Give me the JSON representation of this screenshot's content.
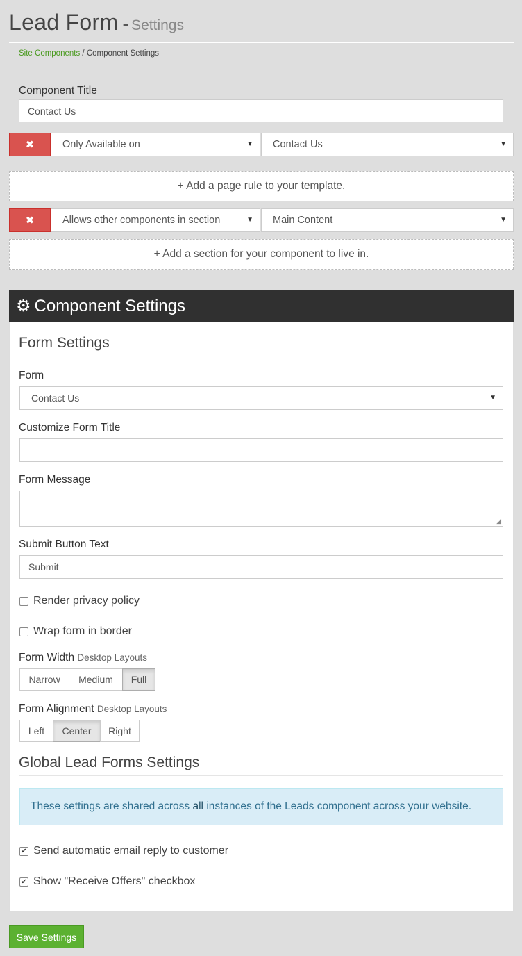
{
  "header": {
    "title": "Lead Form",
    "separator": "-",
    "subtitle": "Settings"
  },
  "breadcrumb": {
    "link": "Site Components",
    "separator": "/",
    "current": "Component Settings"
  },
  "component_title": {
    "label": "Component Title",
    "value": "Contact Us"
  },
  "page_rule": {
    "remove_icon": "✖",
    "condition": "Only Available on",
    "target": "Contact Us",
    "add_text": "+ Add a page rule to your template."
  },
  "section_rule": {
    "remove_icon": "✖",
    "condition": "Allows other components in section",
    "target": "Main Content",
    "add_text": "+ Add a section for your component to live in."
  },
  "panel": {
    "title": "Component Settings",
    "icon": "gear-icon"
  },
  "form_settings": {
    "heading": "Form Settings",
    "form_label": "Form",
    "form_value": "Contact Us",
    "custom_title_label": "Customize Form Title",
    "custom_title_value": "",
    "message_label": "Form Message",
    "message_value": "",
    "submit_label": "Submit Button Text",
    "submit_value": "Submit",
    "privacy_label": "Render privacy policy",
    "privacy_checked": false,
    "border_label": "Wrap form in border",
    "border_checked": false,
    "width_label": "Form Width",
    "width_hint": "Desktop Layouts",
    "width_options": [
      "Narrow",
      "Medium",
      "Full"
    ],
    "width_selected": "Full",
    "align_label": "Form Alignment",
    "align_hint": "Desktop Layouts",
    "align_options": [
      "Left",
      "Center",
      "Right"
    ],
    "align_selected": "Center"
  },
  "global_settings": {
    "heading": "Global Lead Forms Settings",
    "info_before": "These settings are shared across ",
    "info_emphasis": "all",
    "info_after": " instances of the Leads component across your website.",
    "auto_reply_label": "Send automatic email reply to customer",
    "auto_reply_checked": true,
    "offers_label": "Show \"Receive Offers\" checkbox",
    "offers_checked": true
  },
  "save_button": "Save Settings",
  "colors": {
    "danger": "#d9534f",
    "success": "#5cb131",
    "panel_header": "#303030",
    "info_bg": "#d9edf7",
    "link": "#4a9a1f"
  }
}
